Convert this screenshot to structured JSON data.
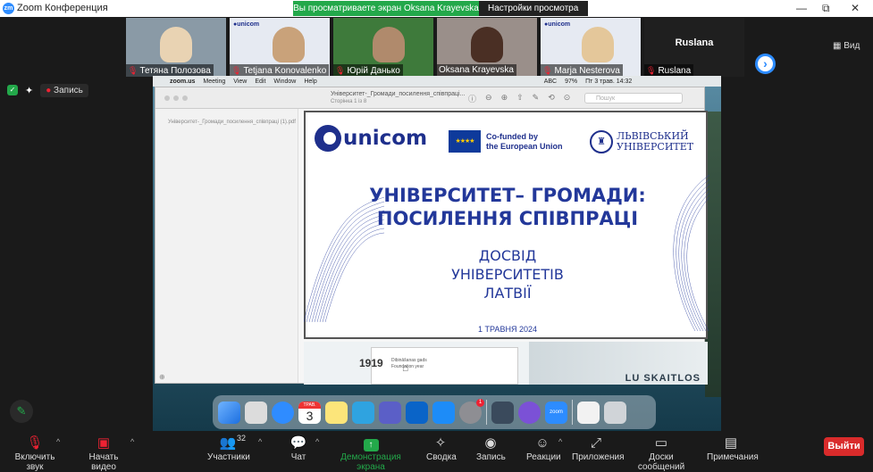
{
  "window": {
    "app_icon": "zm",
    "title": "Zoom Конференция",
    "minimize": "—",
    "restore": "⧉",
    "close": "✕"
  },
  "banner": {
    "sharing_text": "Вы просматриваете экран Oksana Krayevska",
    "view_options": "Настройки просмотра",
    "view_options_icon": "chevron-down-icon"
  },
  "gallery": {
    "participants": [
      {
        "name": "Тетяна Полозова",
        "muted": true
      },
      {
        "name": "Tetjana Konovalenko",
        "muted": true
      },
      {
        "name": "Юрій Данько",
        "muted": true
      },
      {
        "name": "Oksana Krayevska",
        "muted": false
      },
      {
        "name": "Marja Nesterova",
        "muted": true
      },
      {
        "name": "Ruslana",
        "muted": true,
        "title": "Ruslana"
      }
    ],
    "view_label": "Вид"
  },
  "recording": {
    "label": "Запись"
  },
  "mac": {
    "menu": [
      "zoom.us",
      "Meeting",
      "View",
      "Edit",
      "Window",
      "Help"
    ],
    "status": "Пт 3 трав. 14:32",
    "lang": "ABC",
    "battery": "97%"
  },
  "preview": {
    "doc_title": "Університет-_Громади_посилення_співпраці...",
    "page_info": "Сторінка 1 із 8",
    "sidebar_file": "Університет-_Громади_посилення_співпраці (1).pdf",
    "search_placeholder": "Пошук"
  },
  "slide": {
    "unicom": "unicom",
    "eu_line1": "Co-funded by",
    "eu_line2": "the European Union",
    "lviv_line1": "ЛЬВІВСЬКИЙ",
    "lviv_line2": "УНІВЕРСИТЕТ",
    "title_line1": "УНІВЕРСИТЕТ– ГРОМАДИ:",
    "title_line2": "ПОСИЛЕННЯ СПІВПРАЦІ",
    "sub_line1": "ДОСВІД",
    "sub_line2": "УНІВЕРСИТЕТІВ",
    "sub_line3": "ЛАТВІЇ",
    "date": "1 ТРАВНЯ 2024"
  },
  "slide2": {
    "year": "1919",
    "label1": "Dibināšanas gads",
    "label2": "Foundation year",
    "building_text": "LU SKAITLOS"
  },
  "dock": {
    "calendar_month": "ТРАВ.",
    "calendar_day": "3",
    "badge": "1",
    "zoom_label": "zoom"
  },
  "toolbar": {
    "mute": "Включить звук",
    "video": "Начать видео",
    "participants": "Участники",
    "participants_count": "32",
    "chat": "Чат",
    "share": "Демонстрация экрана",
    "summary": "Сводка",
    "record": "Запись",
    "reactions": "Реакции",
    "apps": "Приложения",
    "whiteboards": "Доски сообщений",
    "notes": "Примечания",
    "exit": "Выйти"
  },
  "colors": {
    "zoom_blue": "#2d8cff",
    "share_green": "#23a84a",
    "exit_red": "#d92b2b",
    "slide_blue": "#23389a"
  }
}
